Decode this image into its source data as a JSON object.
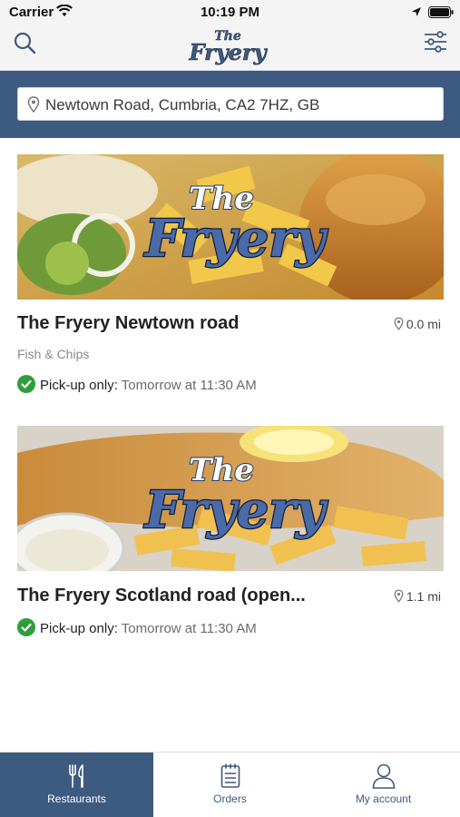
{
  "status_bar": {
    "carrier": "Carrier",
    "time": "10:19 PM"
  },
  "nav": {
    "logo_line1": "The",
    "logo_line2": "Fryery",
    "icons": [
      "search-icon",
      "filter-sliders-icon"
    ]
  },
  "location": {
    "value": "Newtown Road, Cumbria, CA2 7HZ, GB",
    "icon": "map-pin-icon"
  },
  "restaurants": [
    {
      "name": "The Fryery Newtown road",
      "distance": "0.0 mi",
      "category": "Fish & Chips",
      "pickup_label": "Pick-up only:",
      "pickup_time": "Tomorrow at 11:30 AM",
      "logo_line1": "The",
      "logo_line2": "Fryery"
    },
    {
      "name": "The Fryery Scotland road (open...",
      "distance": "1.1 mi",
      "pickup_label": "Pick-up only:",
      "pickup_time": "Tomorrow at 11:30 AM",
      "logo_line1": "The",
      "logo_line2": "Fryery"
    }
  ],
  "tabs": [
    {
      "label": "Restaurants",
      "icon": "fork-knife-icon",
      "active": true
    },
    {
      "label": "Orders",
      "icon": "clipboard-icon",
      "active": false
    },
    {
      "label": "My account",
      "icon": "user-icon",
      "active": false
    }
  ],
  "colors": {
    "brand": "#3d5a80",
    "success": "#2e9e3c",
    "background": "#f4f4f4"
  }
}
